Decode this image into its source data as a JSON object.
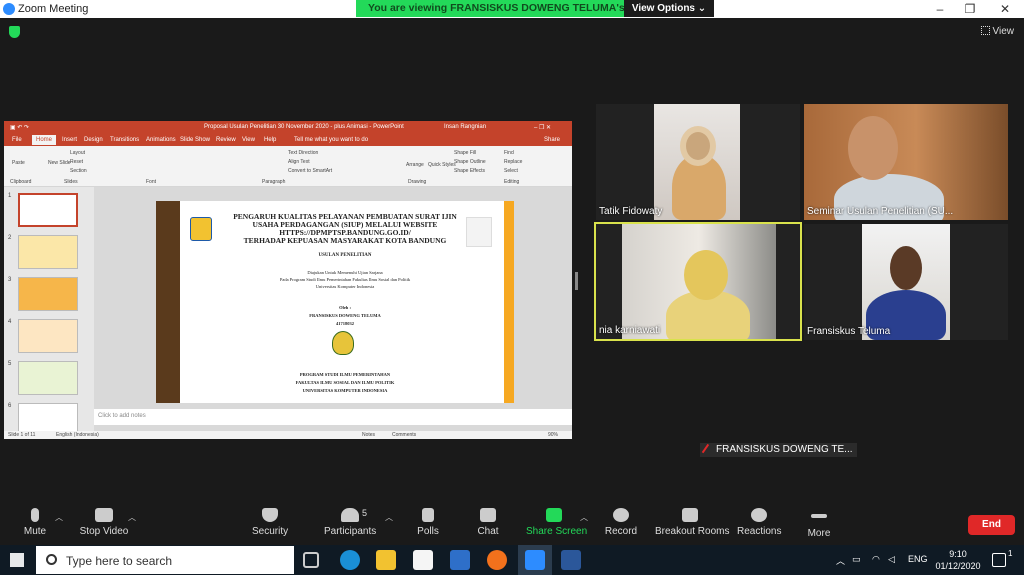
{
  "window": {
    "title": "Zoom Meeting",
    "min": "–",
    "max": "❐",
    "close": "✕"
  },
  "banner": {
    "text": "You are viewing FRANSISKUS DOWENG TELUMA's screen",
    "view_options": "View Options ⌄"
  },
  "view_label": "View",
  "ppt": {
    "title": "Proposal Usulan Penelitian 30 November 2020 - plus Animasi - PowerPoint",
    "user": "Insan Rangnian",
    "tabs": [
      "File",
      "Home",
      "Insert",
      "Design",
      "Transitions",
      "Animations",
      "Slide Show",
      "Review",
      "View",
      "Help"
    ],
    "tell_me": "Tell me what you want to do",
    "share": "Share",
    "ribbon_groups": [
      "Clipboard",
      "Slides",
      "Font",
      "Paragraph",
      "Drawing",
      "Editing"
    ],
    "ribbon_items": {
      "paste": "Paste",
      "new_slide": "New Slide",
      "layout": "Layout",
      "reset": "Reset",
      "section": "Section",
      "text_direction": "Text Direction",
      "align_text": "Align Text",
      "smartart": "Convert to SmartArt",
      "arrange": "Arrange",
      "quick_styles": "Quick Styles",
      "shape_fill": "Shape Fill",
      "shape_outline": "Shape Outline",
      "shape_effects": "Shape Effects",
      "find": "Find",
      "replace": "Replace",
      "select": "Select"
    },
    "thumb_numbers": [
      "1",
      "2",
      "3",
      "4",
      "5",
      "6"
    ],
    "notes": "Click to add notes",
    "status_left": "Slide 1 of 11",
    "status_lang": "English (Indonesia)",
    "status_notes": "Notes",
    "status_comments": "Comments",
    "zoom": "90%"
  },
  "slide": {
    "title_lines": [
      "PENGARUH KUALITAS PELAYANAN PEMBUATAN SURAT IJIN",
      "USAHA PERDAGANGAN (SIUP) MELALUI WEBSITE",
      "HTTPS://DPMPTSP.BANDUNG.GO.ID/",
      "TERHADAP KEPUASAN MASYARAKAT KOTA BANDUNG"
    ],
    "subtitle": "USULAN PENELITIAN",
    "purpose_lines": [
      "Diajukan Untuk Memenuhi Ujian Sarjana",
      "Pada Program Studi Ilmu Pemerintahan Fakultas Ilmu Sosial dan Politik",
      "Universitas Komputer Indonesia"
    ],
    "oleh": "Oleh :",
    "author": "FRANSISKUS DOWENG TELUMA",
    "nim": "41718032",
    "footer_lines": [
      "PROGRAM STUDI ILMU PEMERINTAHAN",
      "FAKULTAS ILMU SOSIAL DAN ILMU POLITIK",
      "UNIVERSITAS KOMPUTER INDONESIA"
    ]
  },
  "participants": [
    {
      "name": "Tatik Fidowaty"
    },
    {
      "name": "Seminar Usulan Penelitian (SU..."
    },
    {
      "name": "nia karniawati"
    },
    {
      "name": "Fransiskus Teluma"
    },
    {
      "name": "FRANSISKUS DOWENG TE..."
    }
  ],
  "toolbar": {
    "mute": "Mute",
    "stop_video": "Stop Video",
    "security": "Security",
    "participants": "Participants",
    "participants_count": "5",
    "polls": "Polls",
    "chat": "Chat",
    "share_screen": "Share Screen",
    "record": "Record",
    "breakout": "Breakout Rooms",
    "reactions": "Reactions",
    "more": "More",
    "end": "End"
  },
  "taskbar": {
    "search_placeholder": "Type here to search",
    "lang": "ENG",
    "time": "9:10",
    "date": "01/12/2020",
    "notif_count": "1"
  }
}
